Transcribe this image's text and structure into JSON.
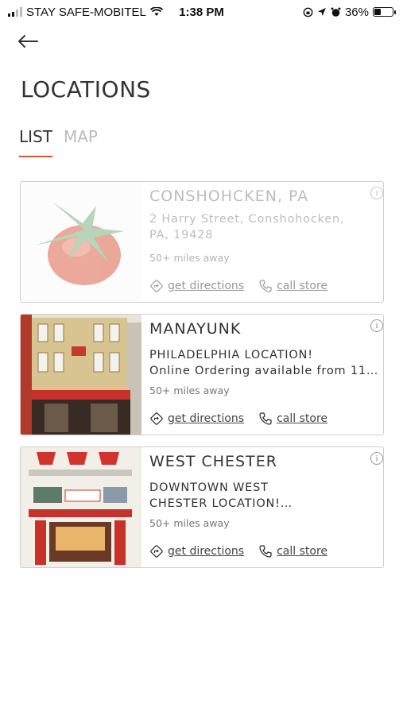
{
  "status_bar": {
    "carrier": "STAY SAFE-MOBITEL",
    "time": "1:38 PM",
    "battery": "36%",
    "battery_level": 0.36
  },
  "header": {
    "title": "LOCATIONS"
  },
  "tabs": [
    {
      "label": "LIST",
      "active": true
    },
    {
      "label": "MAP",
      "active": false
    }
  ],
  "locations": [
    {
      "name": "CONSHOHCKEN, PA",
      "description": "2 Harry Street, Conshohocken,\nPA, 19428",
      "distance": "50+ miles away",
      "directions_label": "get directions",
      "call_label": "call store",
      "thumb": "tomato-logo"
    },
    {
      "name": "MANAYUNK",
      "description": "PHILADELPHIA LOCATION!\nOnline Ordering available from 11…",
      "distance": "50+ miles away",
      "directions_label": "get directions",
      "call_label": "call store",
      "thumb": "storefront-photo"
    },
    {
      "name": "WEST CHESTER",
      "description": "DOWNTOWN WEST\nCHESTER LOCATION!…",
      "distance": "50+ miles away",
      "directions_label": "get directions",
      "call_label": "call store",
      "thumb": "storefront-photo"
    }
  ],
  "colors": {
    "accent": "#d5553a",
    "inactive_tab": "#bcbcbc"
  }
}
